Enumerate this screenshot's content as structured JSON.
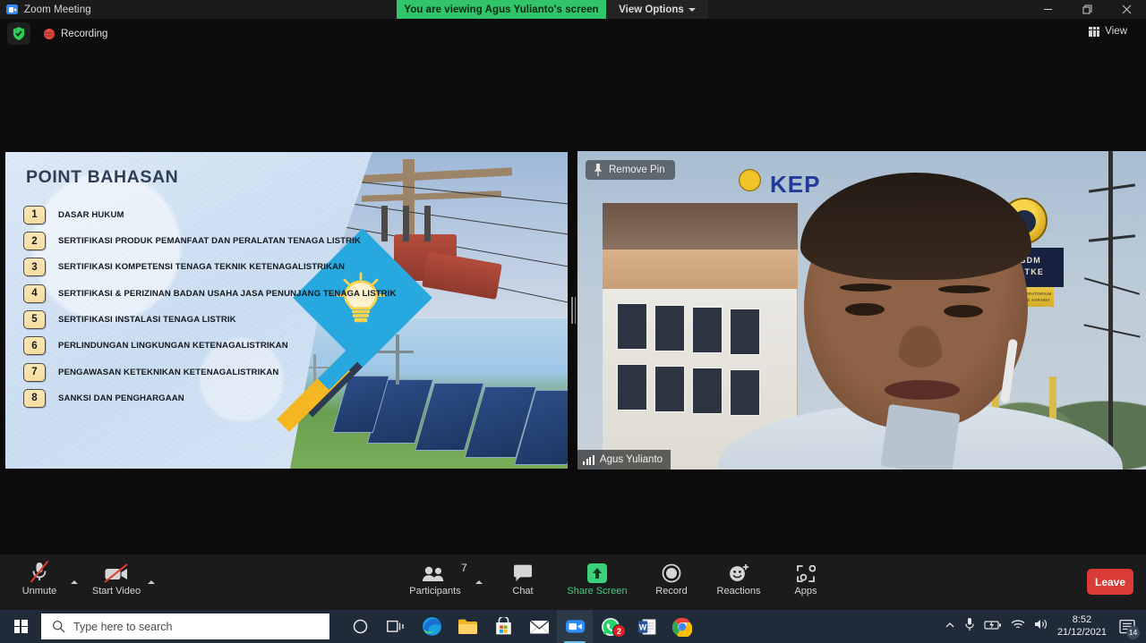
{
  "window": {
    "app_title": "Zoom Meeting",
    "viewing_banner": "You are viewing Agus Yulianto's screen",
    "view_options_label": "View Options",
    "minimize_icon": "minimize-icon",
    "restore_icon": "restore-icon",
    "close_icon": "close-icon",
    "zoom_logo_icon": "zoom-logo-icon"
  },
  "topbar": {
    "shield_icon": "shield-check-icon",
    "recording_label": "Recording",
    "recording_icon": "recording-dot-icon",
    "view_label": "View",
    "view_icon": "grid-view-icon"
  },
  "slide": {
    "title": "POINT BAHASAN",
    "points": [
      {
        "num": "1",
        "text": "DASAR HUKUM"
      },
      {
        "num": "2",
        "text": "SERTIFIKASI PRODUK PEMANFAAT DAN PERALATAN TENAGA LISTRIK"
      },
      {
        "num": "3",
        "text": "SERTIFIKASI KOMPETENSI TENAGA TEKNIK KETENAGALISTRIKAN"
      },
      {
        "num": "4",
        "text": "SERTIFIKASI & PERIZINAN BADAN USAHA JASA PENUNJANG TENAGA LISTRIK"
      },
      {
        "num": "5",
        "text": "SERTIFIKASI INSTALASI TENAGA LISTRIK"
      },
      {
        "num": "6",
        "text": "PERLINDUNGAN LINGKUNGAN KETENAGALISTRIKAN"
      },
      {
        "num": "7",
        "text": "PENGAWASAN KETEKNIKAN KETENAGALISTRIKAN"
      },
      {
        "num": "8",
        "text": "SANKSI DAN PENGHARGAAN"
      }
    ],
    "artwork": {
      "lightbulb_icon": "lightbulb-icon",
      "accent_cyan": "#27a9e0",
      "accent_gold": "#f5b722",
      "accent_navy": "#2c3a52"
    }
  },
  "video": {
    "remove_pin_label": "Remove Pin",
    "pin_icon": "pin-icon",
    "participant_name": "Agus Yulianto",
    "audio_icon": "audio-level-icon",
    "background_sign_text": "KEP",
    "monument_line1": "PPSDM",
    "monument_line2": "KEBTKE",
    "monument_plate_text": "KANTOR LABORATORIUM RUANG KELAS ASRAMA"
  },
  "toolbar": {
    "mute_label": "Unmute",
    "mute_icon": "microphone-muted-icon",
    "video_label": "Start Video",
    "video_icon": "camera-off-icon",
    "participants_label": "Participants",
    "participants_icon": "participants-icon",
    "participants_count": "7",
    "chat_label": "Chat",
    "chat_icon": "chat-bubble-icon",
    "share_label": "Share Screen",
    "share_icon": "share-screen-icon",
    "record_label": "Record",
    "record_icon": "record-circle-icon",
    "reactions_label": "Reactions",
    "reactions_icon": "reactions-smiley-icon",
    "apps_label": "Apps",
    "apps_icon": "apps-icon",
    "leave_label": "Leave",
    "share_color": "#3bd17a",
    "leave_color": "#d93b37"
  },
  "taskbar": {
    "start_icon": "windows-start-icon",
    "search_placeholder": "Type here to search",
    "search_icon": "search-icon",
    "apps": [
      {
        "name": "cortana-icon"
      },
      {
        "name": "task-view-icon"
      },
      {
        "name": "edge-icon"
      },
      {
        "name": "file-explorer-icon"
      },
      {
        "name": "microsoft-store-icon"
      },
      {
        "name": "mail-icon"
      },
      {
        "name": "zoom-icon"
      },
      {
        "name": "whatsapp-icon",
        "badge": "2"
      },
      {
        "name": "word-icon"
      },
      {
        "name": "chrome-icon"
      }
    ],
    "tray": {
      "chevron_icon": "tray-chevron-icon",
      "microphone_icon": "tray-microphone-icon",
      "battery_icon": "tray-battery-icon",
      "wifi_icon": "tray-wifi-icon",
      "volume_icon": "tray-volume-icon",
      "time": "8:52",
      "date": "21/12/2021",
      "notification_icon": "action-center-icon",
      "notification_count": "14"
    }
  }
}
